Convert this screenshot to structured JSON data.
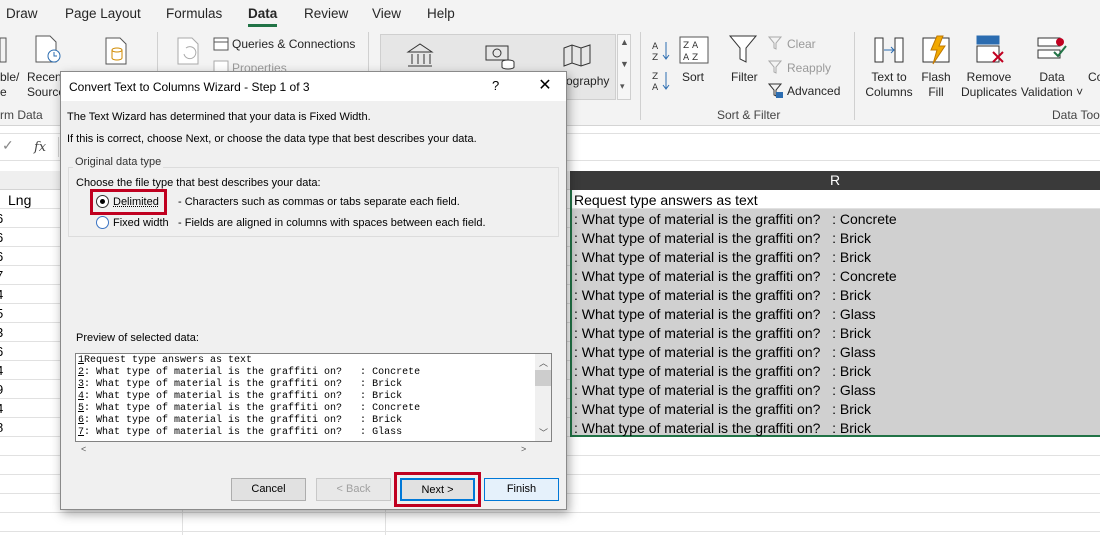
{
  "menu": {
    "tabs": [
      "Draw",
      "Page Layout",
      "Formulas",
      "Data",
      "Review",
      "View",
      "Help"
    ],
    "active": "Data"
  },
  "ribbon": {
    "get_data_partial_line1": "ble/",
    "get_data_partial_line2": "e",
    "recent_sources_line1": "Recen",
    "recent_sources_line2": "Source",
    "transform_group_label": "rm Data",
    "queries_connections": "Queries & Connections",
    "properties": "Properties",
    "geography_label": "ography",
    "sort_label": "Sort",
    "filter_label": "Filter",
    "clear_label": "Clear",
    "reapply_label": "Reapply",
    "advanced_label": "Advanced",
    "sort_filter_group": "Sort & Filter",
    "text_to_columns_line1": "Text to",
    "text_to_columns_line2": "Columns",
    "flash_fill_line1": "Flash",
    "flash_fill_line2": "Fill",
    "remove_duplicates_line1": "Remove",
    "remove_duplicates_line2": "Duplicates",
    "data_validation_line1": "Data",
    "data_validation_line2": "Validation",
    "data_tools_group": "Data Tool",
    "consolidate_partial": "Co"
  },
  "formula_bar": {
    "fx_label": "fx"
  },
  "sheet": {
    "col_r_header": "R",
    "lng_header": "Lng",
    "row_partial_values": [
      "6",
      "6",
      "6",
      "7",
      "4",
      "5",
      "3",
      "6",
      "4",
      "9",
      "4",
      "8"
    ],
    "r_header_cell": "Request type answers as text",
    "r_cells": [
      ": What type of material is the graffiti on?   : Concrete",
      ": What type of material is the graffiti on?   : Brick",
      ": What type of material is the graffiti on?   : Brick",
      ": What type of material is the graffiti on?   : Concrete",
      ": What type of material is the graffiti on?   : Brick",
      ": What type of material is the graffiti on?   : Glass",
      ": What type of material is the graffiti on?   : Brick",
      ": What type of material is the graffiti on?   : Glass",
      ": What type of material is the graffiti on?   : Brick",
      ": What type of material is the graffiti on?   : Glass",
      ": What type of material is the graffiti on?   : Brick",
      ": What type of material is the graffiti on?   : Brick"
    ]
  },
  "dialog": {
    "title": "Convert Text to Columns Wizard - Step 1 of 3",
    "help": "?",
    "close": "✕",
    "intro1": "The Text Wizard has determined that your data is Fixed Width.",
    "intro2": "If this is correct, choose Next, or choose the data type that best describes your data.",
    "group_legend": "Original data type",
    "choose_label": "Choose the file type that best describes your data:",
    "option_delimited": "Delimited",
    "option_delimited_desc": "- Characters such as commas or tabs separate each field.",
    "option_fixed": "Fixed width",
    "option_fixed_desc": "- Fields are aligned in columns with spaces between each field.",
    "selected_option": "Delimited",
    "preview_label": "Preview of selected data:",
    "preview_lines": [
      {
        "num": "1",
        "text": "Request type answers as text"
      },
      {
        "num": "2",
        "text": ": What type of material is the graffiti on?   : Concrete"
      },
      {
        "num": "3",
        "text": ": What type of material is the graffiti on?   : Brick"
      },
      {
        "num": "4",
        "text": ": What type of material is the graffiti on?   : Brick"
      },
      {
        "num": "5",
        "text": ": What type of material is the graffiti on?   : Concrete"
      },
      {
        "num": "6",
        "text": ": What type of material is the graffiti on?   : Brick"
      },
      {
        "num": "7",
        "text": ": What type of material is the graffiti on?   : Glass"
      }
    ],
    "buttons": {
      "cancel": "Cancel",
      "back": "< Back",
      "next": "Next >",
      "finish": "Finish"
    }
  },
  "colors": {
    "excel_green": "#217346",
    "highlight_red": "#c00020",
    "focus_blue": "#0078d7"
  }
}
